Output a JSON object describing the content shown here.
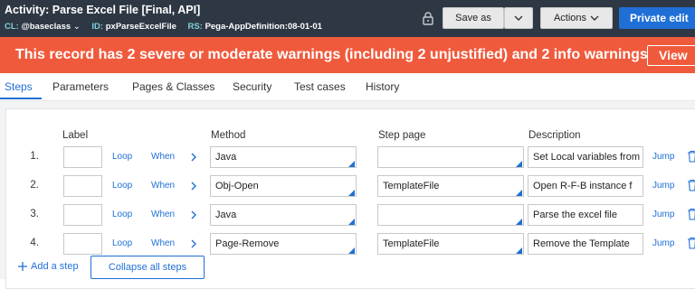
{
  "header": {
    "title": "Activity: Parse Excel File [Final, API]",
    "meta": [
      {
        "key": "CL:",
        "value": "@baseclass"
      },
      {
        "key": "ID:",
        "value": "pxParseExcelFile"
      },
      {
        "key": "RS:",
        "value": "Pega-AppDefinition:08-01-01"
      }
    ],
    "save_as_label": "Save as",
    "actions_label": "Actions",
    "private_edit_label": "Private edit"
  },
  "warning": {
    "text": "This record has 2 severe or moderate warnings (including 2 unjustified) and 2 info warnings",
    "view_label": "View"
  },
  "tabs": [
    {
      "label": "Steps",
      "active": true
    },
    {
      "label": "Parameters"
    },
    {
      "label": "Pages & Classes"
    },
    {
      "label": "Security"
    },
    {
      "label": "Test cases"
    },
    {
      "label": "History"
    }
  ],
  "columns": {
    "label": "Label",
    "method": "Method",
    "step_page": "Step page",
    "description": "Description"
  },
  "steps": [
    {
      "num": "1.",
      "loop": "Loop",
      "when": "When",
      "method": "Java",
      "step_page": "",
      "description": "Set Local variables from",
      "jump": "Jump"
    },
    {
      "num": "2.",
      "loop": "Loop",
      "when": "When",
      "method": "Obj-Open",
      "step_page": "TemplateFile",
      "description": "Open R-F-B instance f",
      "jump": "Jump"
    },
    {
      "num": "3.",
      "loop": "Loop",
      "when": "When",
      "method": "Java",
      "step_page": "",
      "description": "Parse the excel file",
      "jump": "Jump"
    },
    {
      "num": "4.",
      "loop": "Loop",
      "when": "When",
      "method": "Page-Remove",
      "step_page": "TemplateFile",
      "description": "Remove the Template",
      "jump": "Jump"
    }
  ],
  "footer": {
    "add_step_label": "Add a step",
    "collapse_label": "Collapse all steps"
  },
  "colors": {
    "header_bg": "#2e3844",
    "warning_bg": "#f05a3c",
    "accent": "#1f6fd6"
  }
}
